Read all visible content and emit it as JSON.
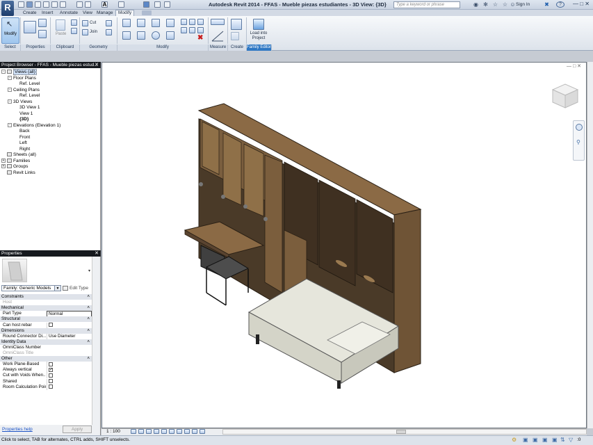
{
  "app": {
    "title": "Autodesk Revit 2014 -    FFAS - Mueble piezas estudiantes - 3D View: {3D}",
    "app_button": "R",
    "search_placeholder": "Type a keyword or phrase",
    "sign_in": "Sign In",
    "help": "?"
  },
  "tabs": [
    "Create",
    "Insert",
    "Annotate",
    "View",
    "Manage",
    "Modify"
  ],
  "active_tab": "Modify",
  "ribbon": {
    "modify_label": "Modify",
    "cut_label": "Cut",
    "join_label": "Join",
    "paste_label": "Paste",
    "load_label": "Load into Project",
    "panels": [
      "Select",
      "Properties",
      "Clipboard",
      "Geometry",
      "Modify",
      "Measure",
      "Create",
      "Family Editor"
    ]
  },
  "project_browser": {
    "header": "Project Browser - FFAS - Mueble piezas estud...",
    "tree": [
      {
        "label": "Views (all)",
        "level": 0,
        "toggle": "-",
        "highlight": true,
        "icon": true
      },
      {
        "label": "Floor Plans",
        "level": 1,
        "toggle": "-"
      },
      {
        "label": "Ref. Level",
        "level": 2
      },
      {
        "label": "Ceiling Plans",
        "level": 1,
        "toggle": "-"
      },
      {
        "label": "Ref. Level",
        "level": 2
      },
      {
        "label": "3D Views",
        "level": 1,
        "toggle": "-"
      },
      {
        "label": "3D View 1",
        "level": 2
      },
      {
        "label": "View 1",
        "level": 2
      },
      {
        "label": "{3D}",
        "level": 2,
        "bold": true
      },
      {
        "label": "Elevations (Elevation 1)",
        "level": 1,
        "toggle": "-"
      },
      {
        "label": "Back",
        "level": 2
      },
      {
        "label": "Front",
        "level": 2
      },
      {
        "label": "Left",
        "level": 2
      },
      {
        "label": "Right",
        "level": 2
      },
      {
        "label": "Sheets (all)",
        "level": 0,
        "icon": true
      },
      {
        "label": "Families",
        "level": 0,
        "toggle": "+",
        "icon": true
      },
      {
        "label": "Groups",
        "level": 0,
        "toggle": "+",
        "icon": true
      },
      {
        "label": "Revit Links",
        "level": 0,
        "icon": true
      }
    ]
  },
  "properties": {
    "header": "Properties",
    "family": "Family: Generic Models",
    "edit_type": "Edit Type",
    "rows": [
      {
        "type": "cat",
        "label": "Constraints"
      },
      {
        "type": "prop",
        "label": "Host",
        "value": "",
        "disabled": true
      },
      {
        "type": "cat",
        "label": "Mechanical"
      },
      {
        "type": "prop",
        "label": "Part Type",
        "value": "Normal",
        "field": true
      },
      {
        "type": "cat",
        "label": "Structural"
      },
      {
        "type": "prop",
        "label": "Can host rebar",
        "check": false
      },
      {
        "type": "cat",
        "label": "Dimensions"
      },
      {
        "type": "prop",
        "label": "Round Connector Di...",
        "value": "Use Diameter"
      },
      {
        "type": "cat",
        "label": "Identity Data"
      },
      {
        "type": "prop",
        "label": "OmniClass Number",
        "value": ""
      },
      {
        "type": "prop",
        "label": "OmniClass Title",
        "value": "",
        "disabled": true
      },
      {
        "type": "cat",
        "label": "Other"
      },
      {
        "type": "prop",
        "label": "Work Plane-Based",
        "check": false
      },
      {
        "type": "prop",
        "label": "Always vertical",
        "check": true
      },
      {
        "type": "prop",
        "label": "Cut with Voids When...",
        "check": false
      },
      {
        "type": "prop",
        "label": "Shared",
        "check": false
      },
      {
        "type": "prop",
        "label": "Room Calculation Point",
        "check": false
      }
    ],
    "help_link": "Properties help",
    "apply": "Apply"
  },
  "view_control": {
    "scale": "1 : 100"
  },
  "status_text": "Click to select, TAB for alternates, CTRL adds, SHIFT unselects.",
  "status_right": ":0"
}
